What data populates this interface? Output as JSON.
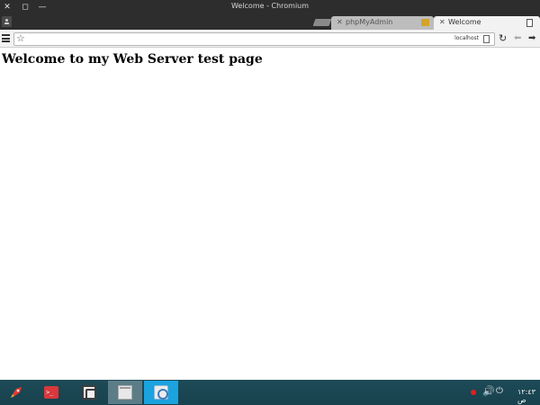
{
  "window": {
    "title": "Welcome - Chromium",
    "close_glyph": "✕",
    "maximize_glyph": "◻",
    "minimize_glyph": "—"
  },
  "tabs": [
    {
      "label": "phpMyAdmin",
      "close_glyph": "✕",
      "active": false
    },
    {
      "label": "Welcome",
      "close_glyph": "✕",
      "active": true
    }
  ],
  "toolbar": {
    "url_host": "localhost",
    "star_glyph": "☆",
    "reload_glyph": "↻",
    "back_glyph": "⬅",
    "forward_glyph": "➡"
  },
  "page": {
    "heading": "Welcome to my Web Server test page"
  },
  "taskbar": {
    "term_glyph": ">_",
    "volume_glyph": "🔊",
    "power_glyph": "⏻",
    "clock": "١٢:٤٣ ص"
  },
  "colors": {
    "titlebar": "#2d2d2d",
    "taskbar": "#1e4b58",
    "active_task": "#1aa3df",
    "record_dot": "#e02020"
  }
}
